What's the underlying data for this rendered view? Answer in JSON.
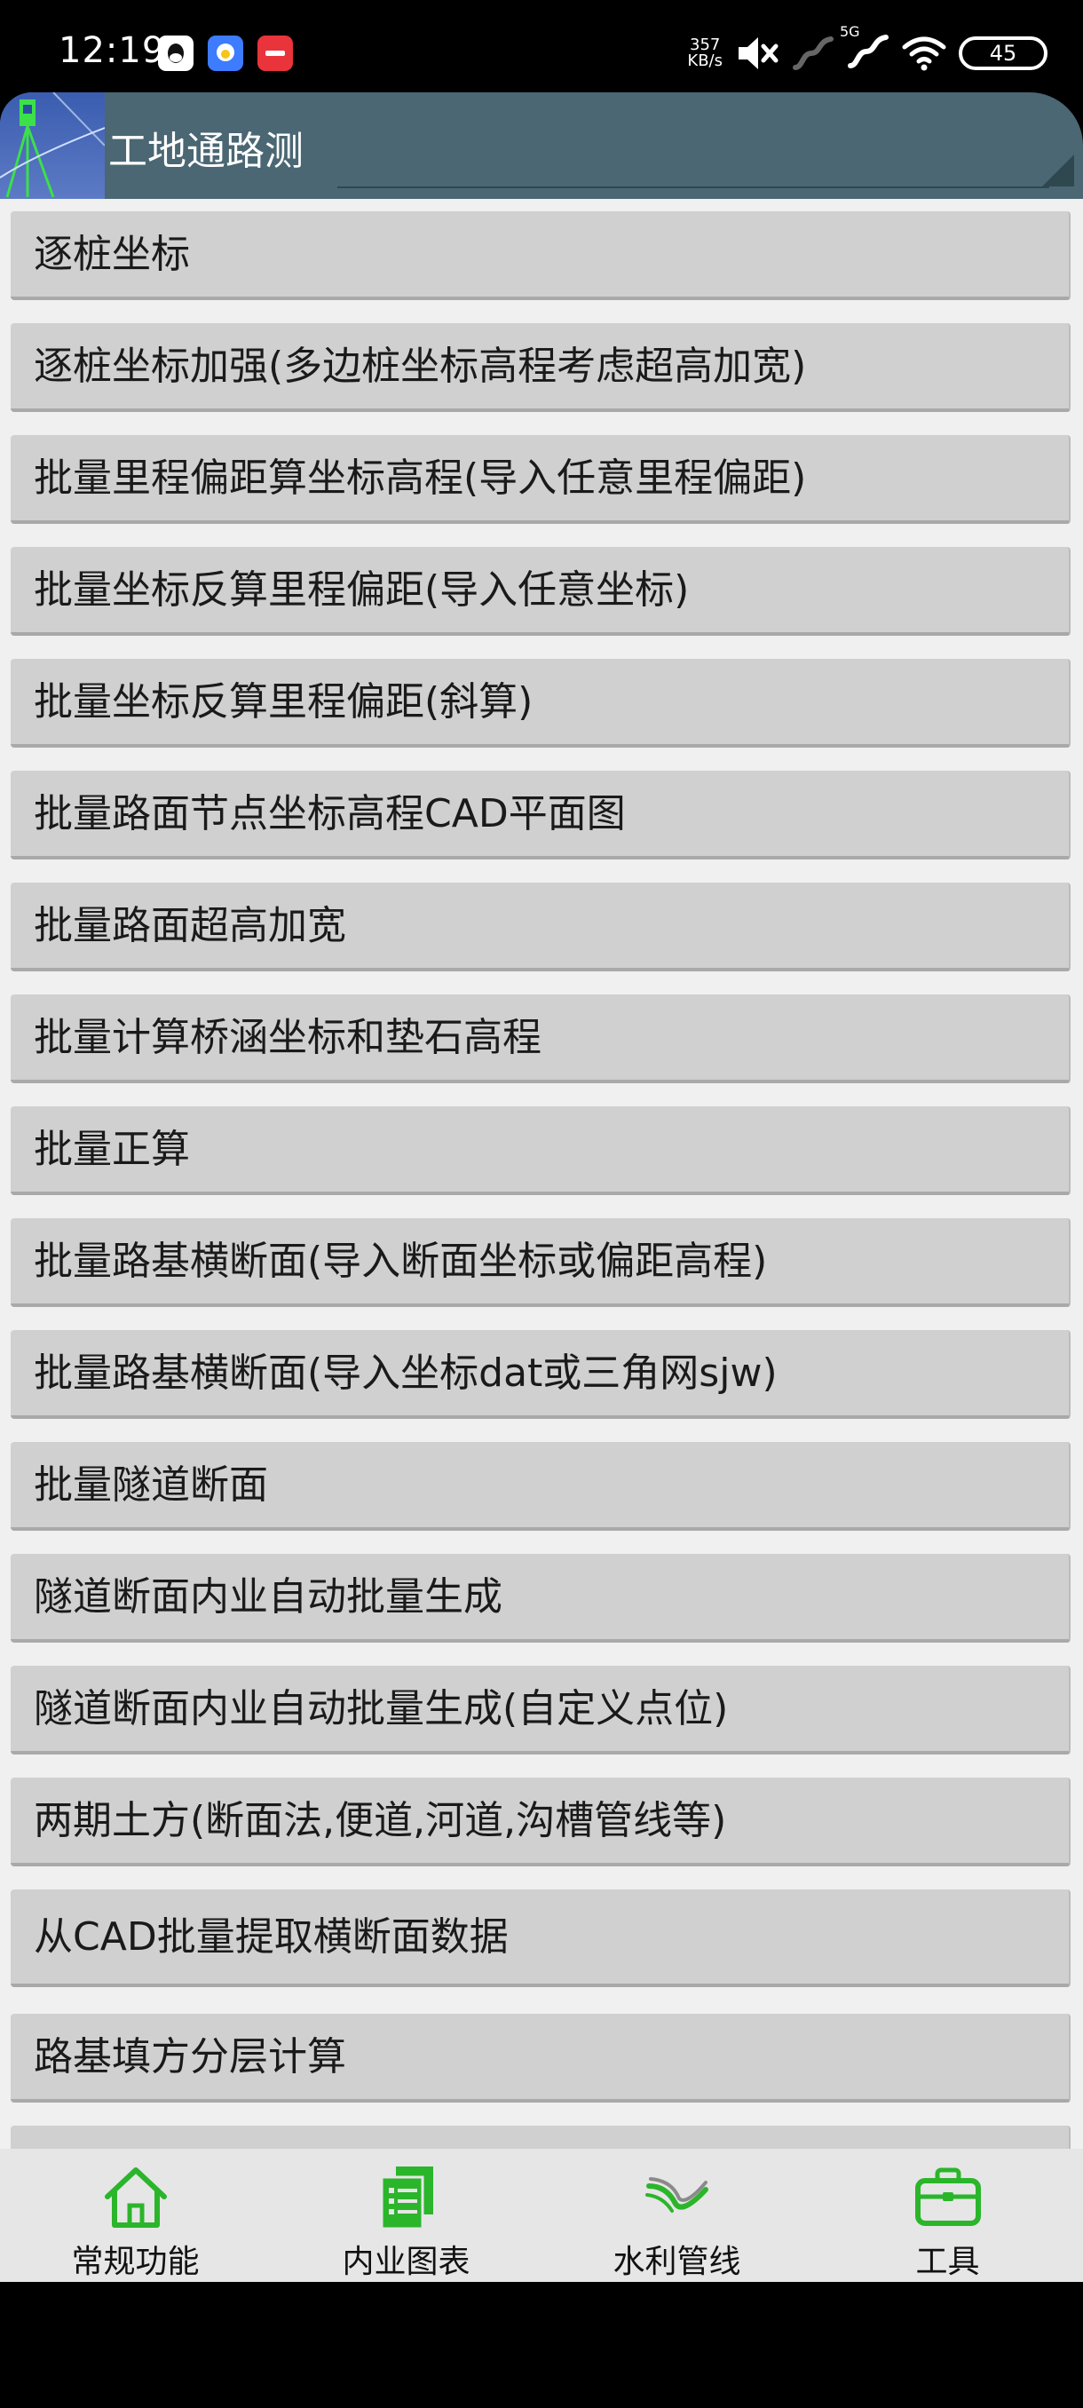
{
  "status": {
    "time": "12:19",
    "net_speed_value": "357",
    "net_speed_unit": "KB/s",
    "network_type": "5G",
    "battery": "45"
  },
  "app": {
    "title": "工地通路测"
  },
  "menu": [
    "逐桩坐标",
    "逐桩坐标加强(多边桩坐标高程考虑超高加宽)",
    "批量里程偏距算坐标高程(导入任意里程偏距)",
    "批量坐标反算里程偏距(导入任意坐标)",
    "批量坐标反算里程偏距(斜算)",
    "批量路面节点坐标高程CAD平面图",
    "批量路面超高加宽",
    "批量计算桥涵坐标和垫石高程",
    "批量正算",
    "批量路基横断面(导入断面坐标或偏距高程)",
    "批量路基横断面(导入坐标dat或三角网sjw)",
    "批量隧道断面",
    "隧道断面内业自动批量生成",
    "隧道断面内业自动批量生成(自定义点位)",
    "两期土方(断面法,便道,河道,沟槽管线等)",
    "从CAD批量提取横断面数据",
    "路基填方分层计算"
  ],
  "nav": [
    {
      "label": "常规功能",
      "icon": "home-icon"
    },
    {
      "label": "内业图表",
      "icon": "documents-icon"
    },
    {
      "label": "水利管线",
      "icon": "pipeline-icon"
    },
    {
      "label": "工具",
      "icon": "toolbox-icon"
    }
  ],
  "colors": {
    "accent_green": "#2bb52b",
    "titlebar": "#4a6773",
    "button": "#d0d0d0"
  }
}
